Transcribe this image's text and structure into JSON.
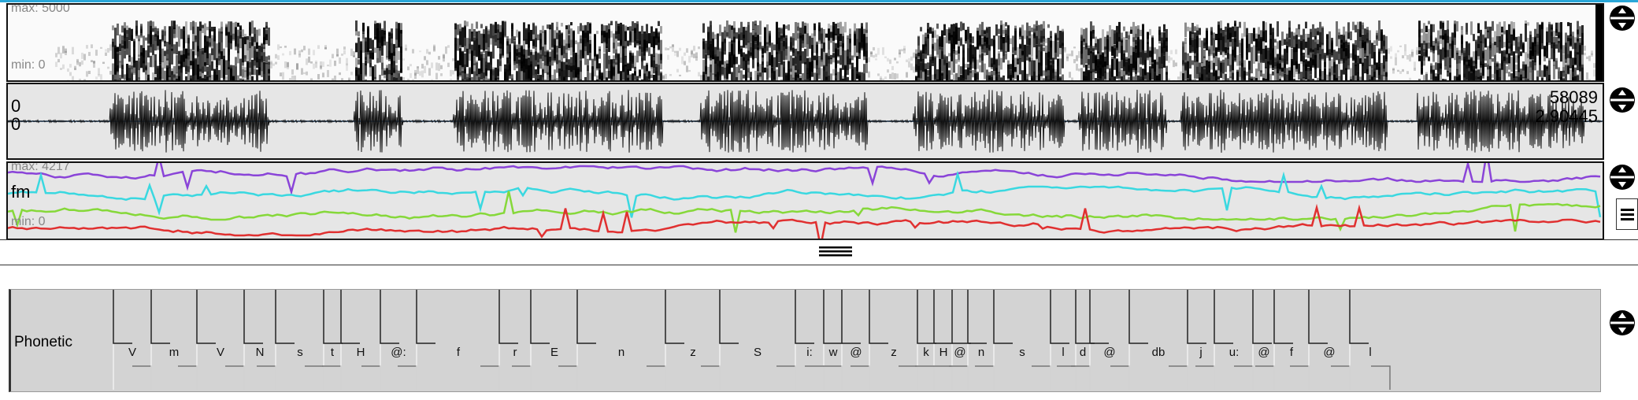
{
  "spectrogram": {
    "max_label": "max: 5000",
    "min_label": "min: 0"
  },
  "oscillogram": {
    "left_top": "0",
    "left_bottom": "0",
    "right_top": "58089",
    "right_bottom": "2.90445"
  },
  "formants": {
    "max_label": "max: 4217",
    "min_label": "min: 0",
    "track_label": "fm",
    "colors": {
      "f1": "#e03030",
      "f2": "#86d83a",
      "f3": "#3ad8e0",
      "f4": "#8a44d8"
    }
  },
  "phonetic": {
    "level_name": "Phonetic",
    "segments": [
      "V",
      "m",
      "V",
      "N",
      "s",
      "t",
      "H",
      "@:",
      "f",
      "r",
      "E",
      "n",
      "z",
      "S",
      "i:",
      "w",
      "@",
      "z",
      "k",
      "H",
      "@",
      "n",
      "s",
      "l",
      "d",
      "@",
      "db",
      "j",
      "u:",
      "@",
      "f",
      "@",
      "l"
    ]
  },
  "icons": {
    "resize": "resize-vertical-icon",
    "menu": "hamburger-icon",
    "handle": "drag-handle-icon"
  }
}
